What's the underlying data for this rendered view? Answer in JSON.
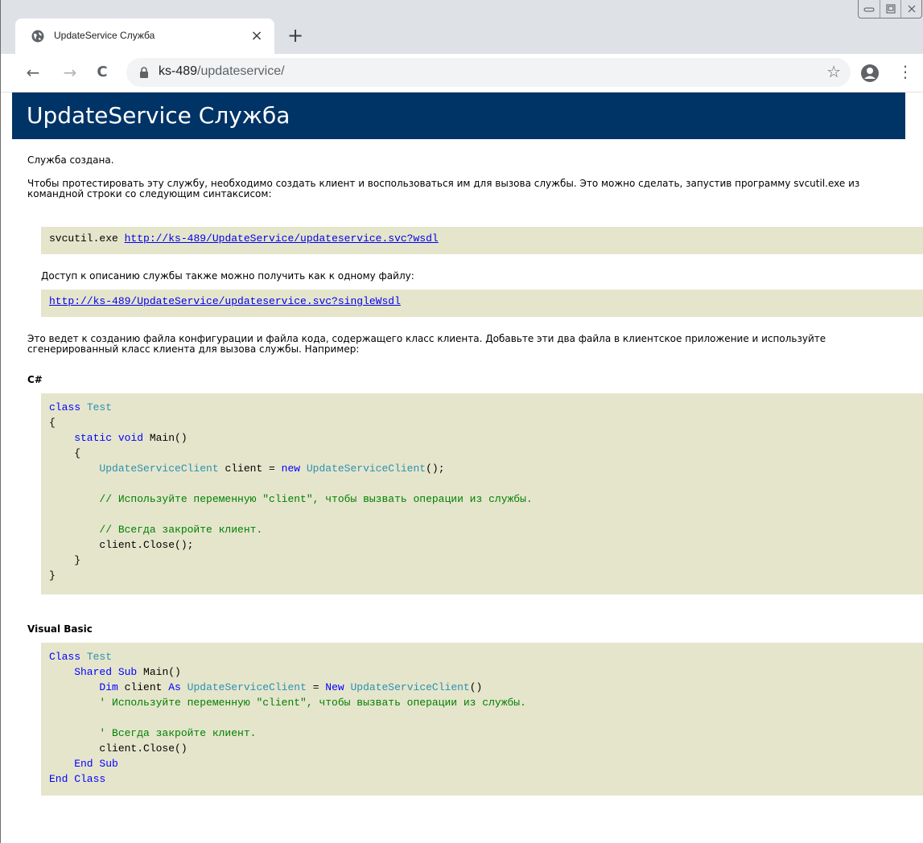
{
  "browser": {
    "tab_title": "UpdateService Служба",
    "tab_close": "×",
    "new_tab": "+",
    "url_host": "ks-489",
    "url_path": "/updateservice/",
    "back": "←",
    "forward": "→",
    "reload": "C",
    "star": "☆",
    "menu": "⋮",
    "icons": [
      "globe-icon",
      "lock-icon",
      "star-icon",
      "profile-icon",
      "menu-icon"
    ]
  },
  "page": {
    "title": "UpdateService Служба",
    "created": "Служба создана.",
    "intro": "Чтобы протестировать эту службу, необходимо создать клиент и воспользоваться им для вызова службы. Это можно сделать, запустив программу svcutil.exe из командной строки со следующим синтаксисом:",
    "svcutil_cmd": "svcutil.exe ",
    "wsdl_link": "http://ks-489/UpdateService/updateservice.svc?wsdl",
    "single_file_text": "Доступ к описанию службы также можно получить как к одному файлу:",
    "single_wsdl_link": "http://ks-489/UpdateService/updateservice.svc?singleWsdl",
    "result_text": "Это ведет к созданию файла конфигурации и файла кода, содержащего класс клиента. Добавьте эти два файла в клиентское приложение и используйте сгенерированный класс клиента для вызова службы. Например:",
    "csharp_label": "C#",
    "vb_label": "Visual Basic"
  },
  "csharp_code": {
    "l1a": "class",
    "l1b": " Test",
    "l2": "{",
    "l3a": "    static",
    "l3b": " void",
    "l3c": " Main()",
    "l4": "    {",
    "l5a": "        UpdateServiceClient",
    "l5b": " client = ",
    "l5c": "new",
    "l5d": " UpdateServiceClient",
    "l5e": "();",
    "l6": "",
    "l7": "        // Используйте переменную \"client\", чтобы вызвать операции из службы.",
    "l8": "",
    "l9": "        // Всегда закройте клиент.",
    "l10": "        client.Close();",
    "l11": "    }",
    "l12": "}"
  },
  "vb_code": {
    "l1a": "Class",
    "l1b": " Test",
    "l2a": "    Shared",
    "l2b": " Sub",
    "l2c": " Main()",
    "l3a": "        Dim",
    "l3b": " client ",
    "l3c": "As",
    "l3d": " UpdateServiceClient",
    "l3e": " = ",
    "l3f": "New",
    "l3g": " UpdateServiceClient",
    "l3h": "()",
    "l4": "        ' Используйте переменную \"client\", чтобы вызвать операции из службы.",
    "l5": "",
    "l6": "        ' Всегда закройте клиент.",
    "l7": "        client.Close()",
    "l8": "    End Sub",
    "l9": "End Class"
  }
}
